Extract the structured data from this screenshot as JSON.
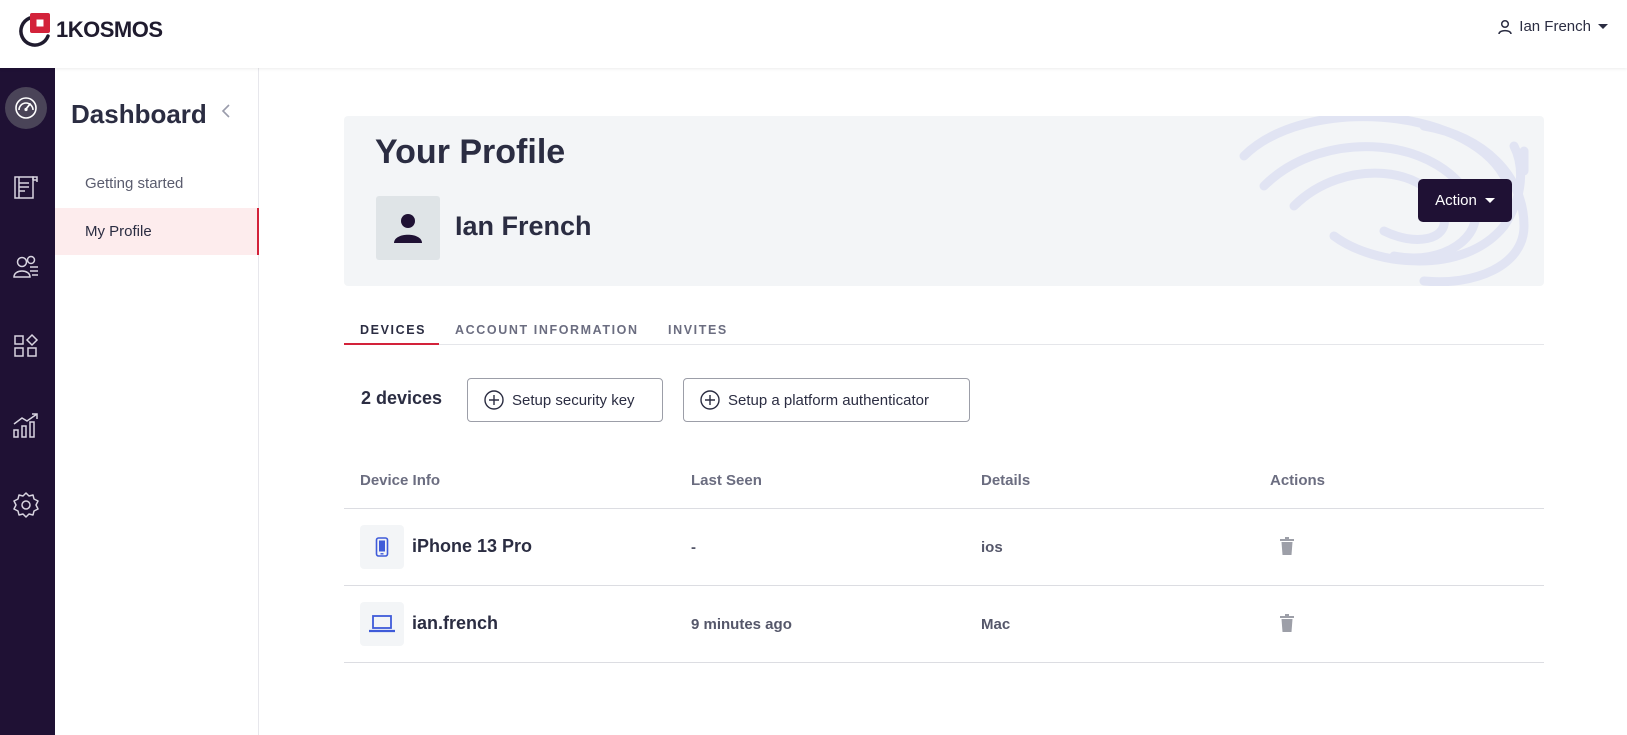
{
  "brand": {
    "name": "1KOSMOS"
  },
  "user_menu": {
    "name": "Ian French"
  },
  "rail": [
    {
      "name": "dashboard-icon",
      "active": true
    },
    {
      "name": "directory-icon"
    },
    {
      "name": "users-icon"
    },
    {
      "name": "apps-icon"
    },
    {
      "name": "reports-icon"
    },
    {
      "name": "settings-icon"
    }
  ],
  "sidebar": {
    "title": "Dashboard",
    "items": [
      {
        "label": "Getting started"
      },
      {
        "label": "My Profile",
        "active": true
      }
    ]
  },
  "profile": {
    "title": "Your Profile",
    "name": "Ian French",
    "action_label": "Action"
  },
  "tabs": [
    {
      "label": "DEVICES",
      "active": true
    },
    {
      "label": "ACCOUNT INFORMATION"
    },
    {
      "label": "INVITES"
    }
  ],
  "devices": {
    "count_label": "2 devices",
    "setup_security_key": "Setup security key",
    "setup_platform_authenticator": "Setup a platform authenticator",
    "columns": [
      "Device Info",
      "Last Seen",
      "Details",
      "Actions"
    ],
    "rows": [
      {
        "icon": "phone-icon",
        "name": "iPhone 13 Pro",
        "last_seen": "-",
        "details": "ios"
      },
      {
        "icon": "laptop-icon",
        "name": "ian.french",
        "last_seen": "9 minutes ago",
        "details": "Mac"
      }
    ]
  },
  "colors": {
    "rail_bg": "#1f1134",
    "accent_red": "#d3223a",
    "device_icon_blue": "#3f5bd9"
  }
}
